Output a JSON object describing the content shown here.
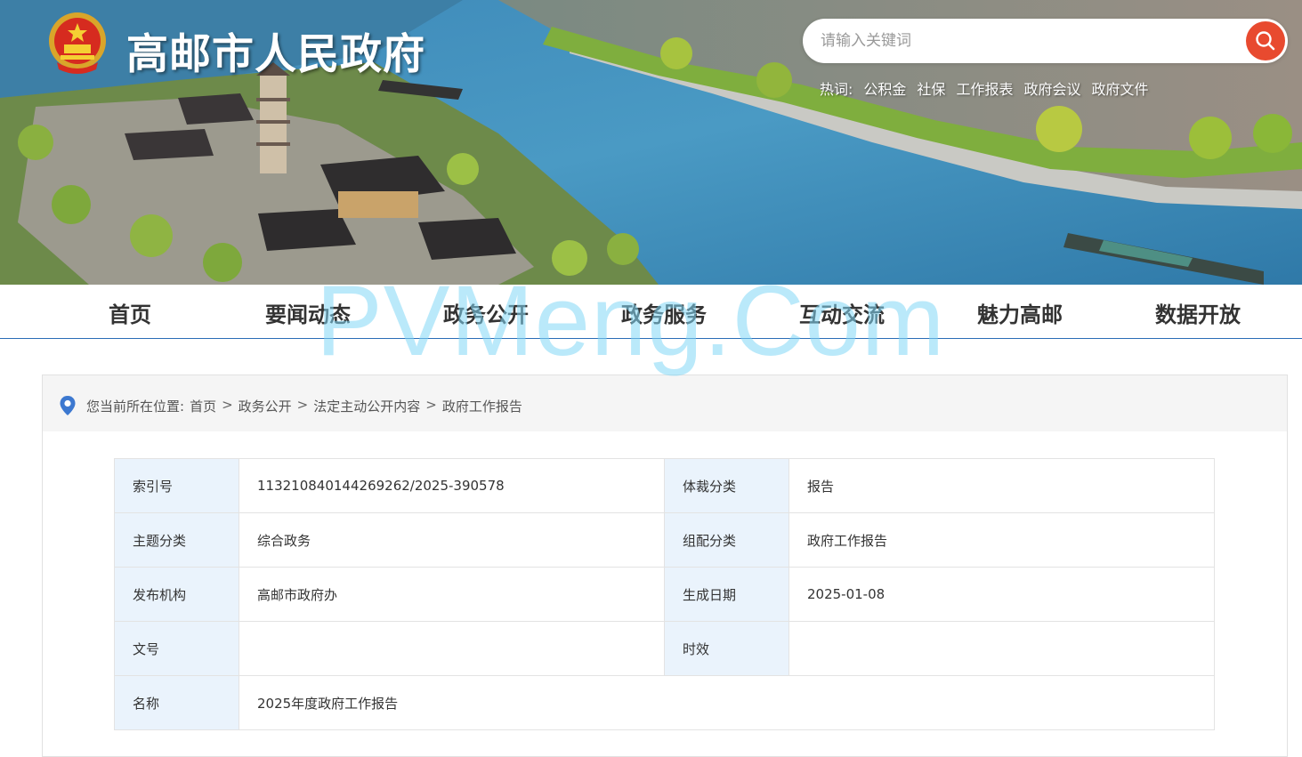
{
  "header": {
    "site_title": "高邮市人民政府",
    "emblem_icon": "national-emblem-icon",
    "search": {
      "placeholder": "请输入关键词",
      "button_icon": "search-icon",
      "button_color": "#e84a2f"
    },
    "hotwords": {
      "label": "热词:",
      "items": [
        "公积金",
        "社保",
        "工作报表",
        "政府会议",
        "政府文件"
      ]
    }
  },
  "nav": {
    "items": [
      "首页",
      "要闻动态",
      "政务公开",
      "政务服务",
      "互动交流",
      "魅力高邮",
      "数据开放"
    ]
  },
  "breadcrumb": {
    "prefix": "您当前所在位置:",
    "items": [
      "首页",
      "政务公开",
      "法定主动公开内容",
      "政府工作报告"
    ],
    "separator": ">",
    "icon": "location-pin-icon"
  },
  "meta": {
    "index_label": "索引号",
    "index_value": "113210840144269262/2025-390578",
    "genre_label": "体裁分类",
    "genre_value": "报告",
    "topic_label": "主题分类",
    "topic_value": "综合政务",
    "group_label": "组配分类",
    "group_value": "政府工作报告",
    "publisher_label": "发布机构",
    "publisher_value": "高邮市政府办",
    "date_label": "生成日期",
    "date_value": "2025-01-08",
    "docno_label": "文号",
    "docno_value": "",
    "validity_label": "时效",
    "validity_value": "",
    "name_label": "名称",
    "name_value": "2025年度政府工作报告"
  },
  "watermark": "PVMeng.Com",
  "colors": {
    "nav_border": "#2a6cb6",
    "label_bg": "#eaf3fc",
    "crumb_bg": "#f5f5f5"
  }
}
